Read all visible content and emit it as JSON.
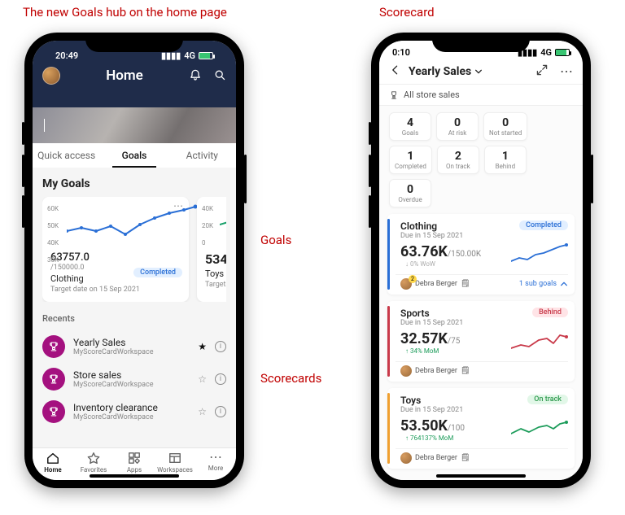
{
  "annot": {
    "left_title": "The new Goals hub on the home page",
    "right_title": "Scorecard",
    "goals": "Goals",
    "scorecards": "Scorecards"
  },
  "left": {
    "status": {
      "time": "20:49",
      "net": "4G"
    },
    "header": {
      "title": "Home"
    },
    "tabs": {
      "quick": "Quick access",
      "goals": "Goals",
      "activity": "Activity",
      "active": "goals"
    },
    "section_title": "My Goals",
    "card1": {
      "yticks": [
        "60K",
        "50K",
        "40K",
        "30K"
      ],
      "value": "63757.0",
      "target": "/150000.0",
      "name": "Clothing",
      "date": "Target date on 15 Sep 2021",
      "status": "Completed"
    },
    "card2": {
      "yticks": [
        "40K",
        "20K",
        "0"
      ],
      "value_partial": "534",
      "name": "Toys",
      "date_partial": "Target"
    },
    "recents_h": "Recents",
    "recents": [
      {
        "title": "Yearly Sales",
        "ws": "MyScoreCardWorkspace",
        "starred": true
      },
      {
        "title": "Store sales",
        "ws": "MyScoreCardWorkspace",
        "starred": false
      },
      {
        "title": "Inventory clearance",
        "ws": "MyScoreCardWorkspace",
        "starred": false
      }
    ],
    "bottom": {
      "home": "Home",
      "fav": "Favorites",
      "apps": "Apps",
      "ws": "Workspaces",
      "more": "More"
    }
  },
  "right": {
    "status": {
      "time": "0:10",
      "net": "4G"
    },
    "title": "Yearly Sales",
    "breadcrumb": "All store sales",
    "chips": [
      {
        "n": "4",
        "l": "Goals"
      },
      {
        "n": "0",
        "l": "At risk"
      },
      {
        "n": "0",
        "l": "Not started"
      },
      {
        "n": "1",
        "l": "Completed"
      },
      {
        "n": "2",
        "l": "On track"
      },
      {
        "n": "1",
        "l": "Behind"
      },
      {
        "n": "0",
        "l": "Overdue"
      }
    ],
    "goals": [
      {
        "name": "Clothing",
        "due": "Due in 15 Sep 2021",
        "value": "63.76K",
        "target": "/150.00K",
        "delta": "0% WoW",
        "delta_dir": "down",
        "status": "Completed",
        "bar": "blue",
        "owner": "Debra Berger",
        "owner_badge": true,
        "sub": "1 sub goals"
      },
      {
        "name": "Sports",
        "due": "Due in 15 Sep 2021",
        "value": "32.57K",
        "target": "/75",
        "delta": "34% MoM",
        "delta_dir": "up",
        "status": "Behind",
        "bar": "red",
        "owner": "Debra Berger",
        "owner_badge": false
      },
      {
        "name": "Toys",
        "due": "Due in 15 Sep 2021",
        "value": "53.50K",
        "target": "/100",
        "delta": "764137% MoM",
        "delta_dir": "up",
        "status": "On track",
        "bar": "orange",
        "owner": "Debra Berger",
        "owner_badge": false
      }
    ]
  },
  "chart_data": [
    {
      "type": "line",
      "title": "Clothing goal sparkline (left card)",
      "ylim": [
        30000,
        60000
      ],
      "x": [
        0,
        1,
        2,
        3,
        4,
        5,
        6,
        7,
        8,
        9
      ],
      "values": [
        40000,
        42000,
        40000,
        43000,
        39000,
        44000,
        48000,
        54000,
        57000,
        60000
      ]
    },
    {
      "type": "line",
      "title": "Toys goal sparkline (left card, partial)",
      "ylim": [
        0,
        40000
      ],
      "x": [
        0,
        1,
        2
      ],
      "values": [
        18000,
        20000,
        22000
      ]
    },
    {
      "type": "line",
      "title": "Clothing scorecard sparkline",
      "x": [
        0,
        1,
        2,
        3,
        4,
        5,
        6,
        7
      ],
      "values": [
        30,
        35,
        32,
        40,
        42,
        50,
        58,
        63
      ]
    },
    {
      "type": "line",
      "title": "Sports scorecard sparkline",
      "x": [
        0,
        1,
        2,
        3,
        4,
        5,
        6,
        7
      ],
      "values": [
        24,
        26,
        25,
        30,
        33,
        29,
        34,
        33
      ]
    },
    {
      "type": "line",
      "title": "Toys scorecard sparkline",
      "x": [
        0,
        1,
        2,
        3,
        4,
        5,
        6,
        7
      ],
      "values": [
        40,
        45,
        42,
        48,
        50,
        47,
        52,
        54
      ]
    }
  ]
}
